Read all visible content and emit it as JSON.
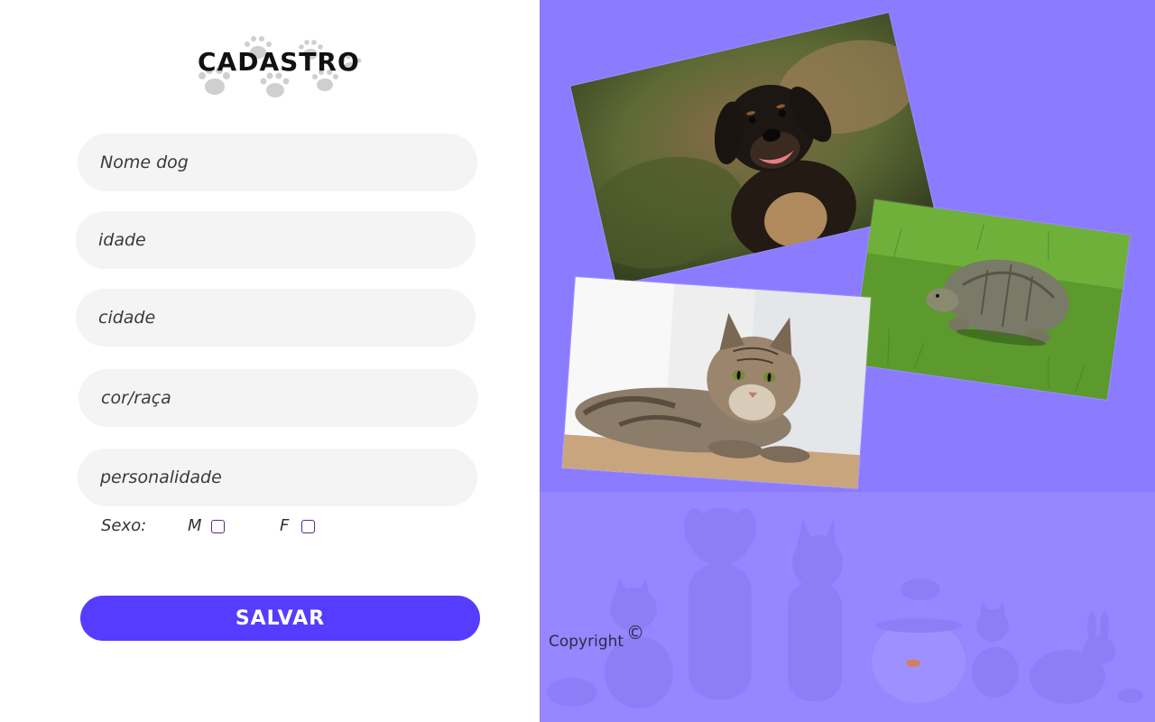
{
  "form": {
    "title": "CADASTRO",
    "fields": [
      {
        "placeholder": "Nome dog"
      },
      {
        "placeholder": "idade"
      },
      {
        "placeholder": "cidade"
      },
      {
        "placeholder": "cor/raça"
      },
      {
        "placeholder": "personalidade"
      }
    ],
    "sexo_label": "Sexo:",
    "option_m": "M",
    "option_f": "F",
    "save_label": "SALVAR"
  },
  "footer": {
    "copyright_label": "Copyright",
    "copyright_symbol": "©"
  },
  "colors": {
    "accent": "#563cff",
    "panel": "#8b7bff",
    "panel_light": "#9686ff",
    "field_bg": "#f4f4f4"
  },
  "images": {
    "dog": "dog-photo",
    "cat": "cat-photo",
    "turtle": "turtle-photo",
    "pets_banner": "pets-silhouette-banner",
    "paw_prints": "paw-prints-decoration"
  }
}
